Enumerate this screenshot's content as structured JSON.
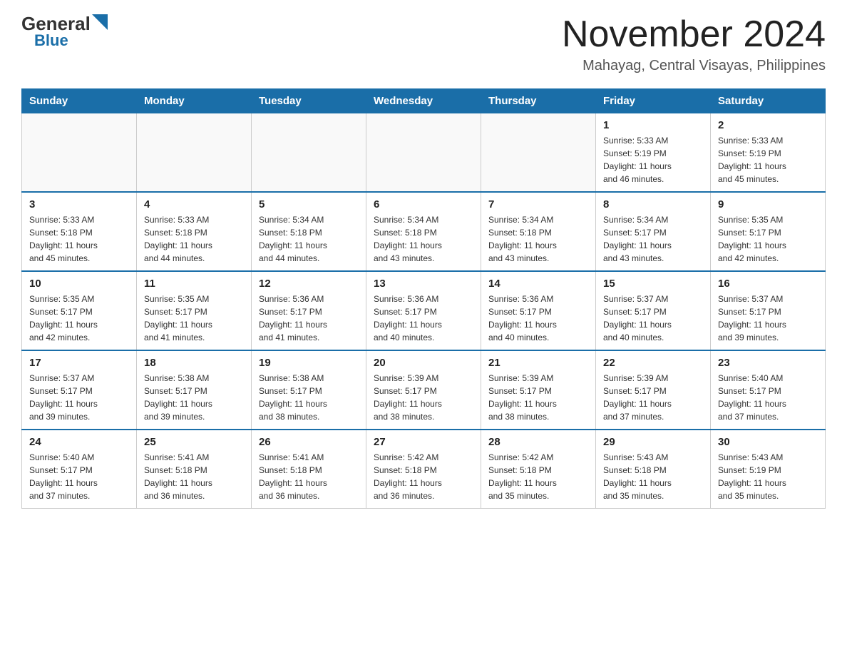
{
  "header": {
    "logo_general": "General",
    "logo_blue": "Blue",
    "month_title": "November 2024",
    "location": "Mahayag, Central Visayas, Philippines"
  },
  "days_of_week": [
    "Sunday",
    "Monday",
    "Tuesday",
    "Wednesday",
    "Thursday",
    "Friday",
    "Saturday"
  ],
  "weeks": [
    [
      {
        "day": "",
        "info": ""
      },
      {
        "day": "",
        "info": ""
      },
      {
        "day": "",
        "info": ""
      },
      {
        "day": "",
        "info": ""
      },
      {
        "day": "",
        "info": ""
      },
      {
        "day": "1",
        "info": "Sunrise: 5:33 AM\nSunset: 5:19 PM\nDaylight: 11 hours\nand 46 minutes."
      },
      {
        "day": "2",
        "info": "Sunrise: 5:33 AM\nSunset: 5:19 PM\nDaylight: 11 hours\nand 45 minutes."
      }
    ],
    [
      {
        "day": "3",
        "info": "Sunrise: 5:33 AM\nSunset: 5:18 PM\nDaylight: 11 hours\nand 45 minutes."
      },
      {
        "day": "4",
        "info": "Sunrise: 5:33 AM\nSunset: 5:18 PM\nDaylight: 11 hours\nand 44 minutes."
      },
      {
        "day": "5",
        "info": "Sunrise: 5:34 AM\nSunset: 5:18 PM\nDaylight: 11 hours\nand 44 minutes."
      },
      {
        "day": "6",
        "info": "Sunrise: 5:34 AM\nSunset: 5:18 PM\nDaylight: 11 hours\nand 43 minutes."
      },
      {
        "day": "7",
        "info": "Sunrise: 5:34 AM\nSunset: 5:18 PM\nDaylight: 11 hours\nand 43 minutes."
      },
      {
        "day": "8",
        "info": "Sunrise: 5:34 AM\nSunset: 5:17 PM\nDaylight: 11 hours\nand 43 minutes."
      },
      {
        "day": "9",
        "info": "Sunrise: 5:35 AM\nSunset: 5:17 PM\nDaylight: 11 hours\nand 42 minutes."
      }
    ],
    [
      {
        "day": "10",
        "info": "Sunrise: 5:35 AM\nSunset: 5:17 PM\nDaylight: 11 hours\nand 42 minutes."
      },
      {
        "day": "11",
        "info": "Sunrise: 5:35 AM\nSunset: 5:17 PM\nDaylight: 11 hours\nand 41 minutes."
      },
      {
        "day": "12",
        "info": "Sunrise: 5:36 AM\nSunset: 5:17 PM\nDaylight: 11 hours\nand 41 minutes."
      },
      {
        "day": "13",
        "info": "Sunrise: 5:36 AM\nSunset: 5:17 PM\nDaylight: 11 hours\nand 40 minutes."
      },
      {
        "day": "14",
        "info": "Sunrise: 5:36 AM\nSunset: 5:17 PM\nDaylight: 11 hours\nand 40 minutes."
      },
      {
        "day": "15",
        "info": "Sunrise: 5:37 AM\nSunset: 5:17 PM\nDaylight: 11 hours\nand 40 minutes."
      },
      {
        "day": "16",
        "info": "Sunrise: 5:37 AM\nSunset: 5:17 PM\nDaylight: 11 hours\nand 39 minutes."
      }
    ],
    [
      {
        "day": "17",
        "info": "Sunrise: 5:37 AM\nSunset: 5:17 PM\nDaylight: 11 hours\nand 39 minutes."
      },
      {
        "day": "18",
        "info": "Sunrise: 5:38 AM\nSunset: 5:17 PM\nDaylight: 11 hours\nand 39 minutes."
      },
      {
        "day": "19",
        "info": "Sunrise: 5:38 AM\nSunset: 5:17 PM\nDaylight: 11 hours\nand 38 minutes."
      },
      {
        "day": "20",
        "info": "Sunrise: 5:39 AM\nSunset: 5:17 PM\nDaylight: 11 hours\nand 38 minutes."
      },
      {
        "day": "21",
        "info": "Sunrise: 5:39 AM\nSunset: 5:17 PM\nDaylight: 11 hours\nand 38 minutes."
      },
      {
        "day": "22",
        "info": "Sunrise: 5:39 AM\nSunset: 5:17 PM\nDaylight: 11 hours\nand 37 minutes."
      },
      {
        "day": "23",
        "info": "Sunrise: 5:40 AM\nSunset: 5:17 PM\nDaylight: 11 hours\nand 37 minutes."
      }
    ],
    [
      {
        "day": "24",
        "info": "Sunrise: 5:40 AM\nSunset: 5:17 PM\nDaylight: 11 hours\nand 37 minutes."
      },
      {
        "day": "25",
        "info": "Sunrise: 5:41 AM\nSunset: 5:18 PM\nDaylight: 11 hours\nand 36 minutes."
      },
      {
        "day": "26",
        "info": "Sunrise: 5:41 AM\nSunset: 5:18 PM\nDaylight: 11 hours\nand 36 minutes."
      },
      {
        "day": "27",
        "info": "Sunrise: 5:42 AM\nSunset: 5:18 PM\nDaylight: 11 hours\nand 36 minutes."
      },
      {
        "day": "28",
        "info": "Sunrise: 5:42 AM\nSunset: 5:18 PM\nDaylight: 11 hours\nand 35 minutes."
      },
      {
        "day": "29",
        "info": "Sunrise: 5:43 AM\nSunset: 5:18 PM\nDaylight: 11 hours\nand 35 minutes."
      },
      {
        "day": "30",
        "info": "Sunrise: 5:43 AM\nSunset: 5:19 PM\nDaylight: 11 hours\nand 35 minutes."
      }
    ]
  ]
}
